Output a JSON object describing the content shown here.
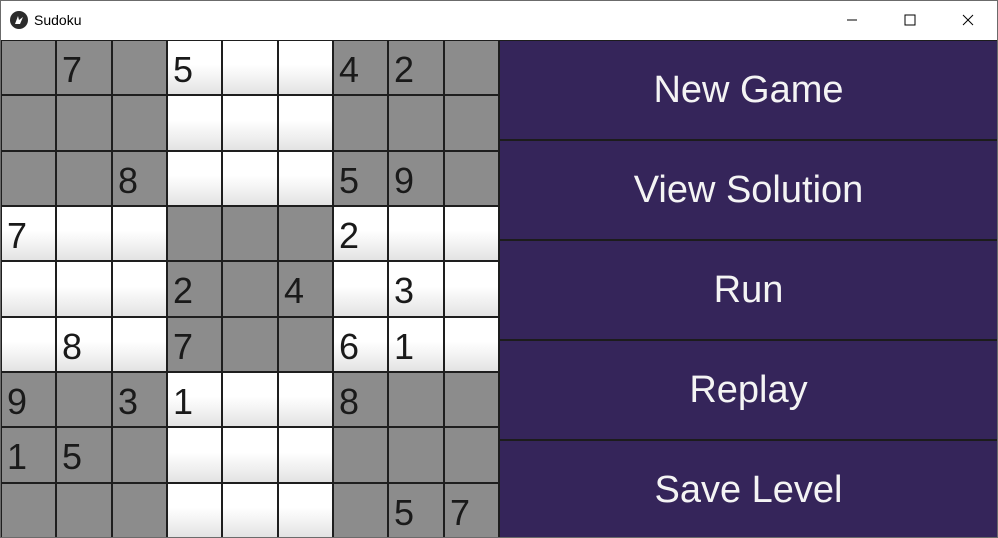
{
  "window": {
    "title": "Sudoku",
    "app_icon": "kivy-icon",
    "controls": {
      "minimize": "minimize-icon",
      "maximize": "maximize-icon",
      "close": "close-icon"
    }
  },
  "board": {
    "rows": [
      [
        "",
        "7",
        "",
        "5",
        "",
        "",
        "4",
        "2",
        ""
      ],
      [
        "",
        "",
        "",
        "",
        "",
        "",
        "",
        "",
        ""
      ],
      [
        "",
        "",
        "8",
        "",
        "",
        "",
        "5",
        "9",
        ""
      ],
      [
        "7",
        "",
        "",
        "",
        "",
        "",
        "2",
        "",
        ""
      ],
      [
        "",
        "",
        "",
        "2",
        "",
        "4",
        "",
        "3",
        ""
      ],
      [
        "",
        "8",
        "",
        "7",
        "",
        "",
        "6",
        "1",
        ""
      ],
      [
        "9",
        "",
        "3",
        "1",
        "",
        "",
        "8",
        "",
        ""
      ],
      [
        "1",
        "5",
        "",
        "",
        "",
        "",
        "",
        "",
        ""
      ],
      [
        "",
        "",
        "",
        "",
        "",
        "",
        "",
        "5",
        "7"
      ]
    ],
    "colors": {
      "shaded_box": "#8c8c8c",
      "light_box": "#ffffff",
      "grid_line": "#1e1e1e",
      "digit": "#1a1a1a"
    }
  },
  "actions": {
    "new_game": "New Game",
    "view_solution": "View Solution",
    "run": "Run",
    "replay": "Replay",
    "save_level": "Save Level"
  },
  "colors": {
    "button_bg": "#35255a",
    "button_text": "#f4f4f4"
  }
}
